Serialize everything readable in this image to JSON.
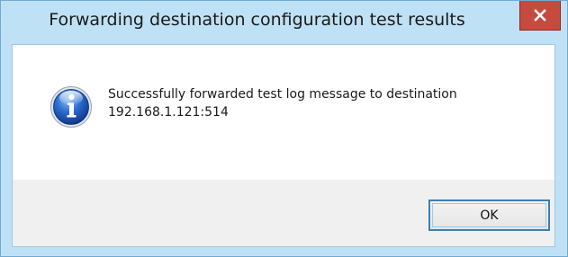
{
  "window": {
    "title": "Forwarding destination configuration test results",
    "close_icon": "close-icon"
  },
  "message": {
    "icon": "info-icon",
    "line1": "Successfully forwarded test log message to destination",
    "line2": "192.168.1.121:514"
  },
  "buttons": {
    "ok_label": "OK"
  },
  "colors": {
    "frame": "#bfe1f5",
    "close_button": "#c64a3f",
    "button_border": "#3c7fb1",
    "footer": "#f0f0f0"
  }
}
